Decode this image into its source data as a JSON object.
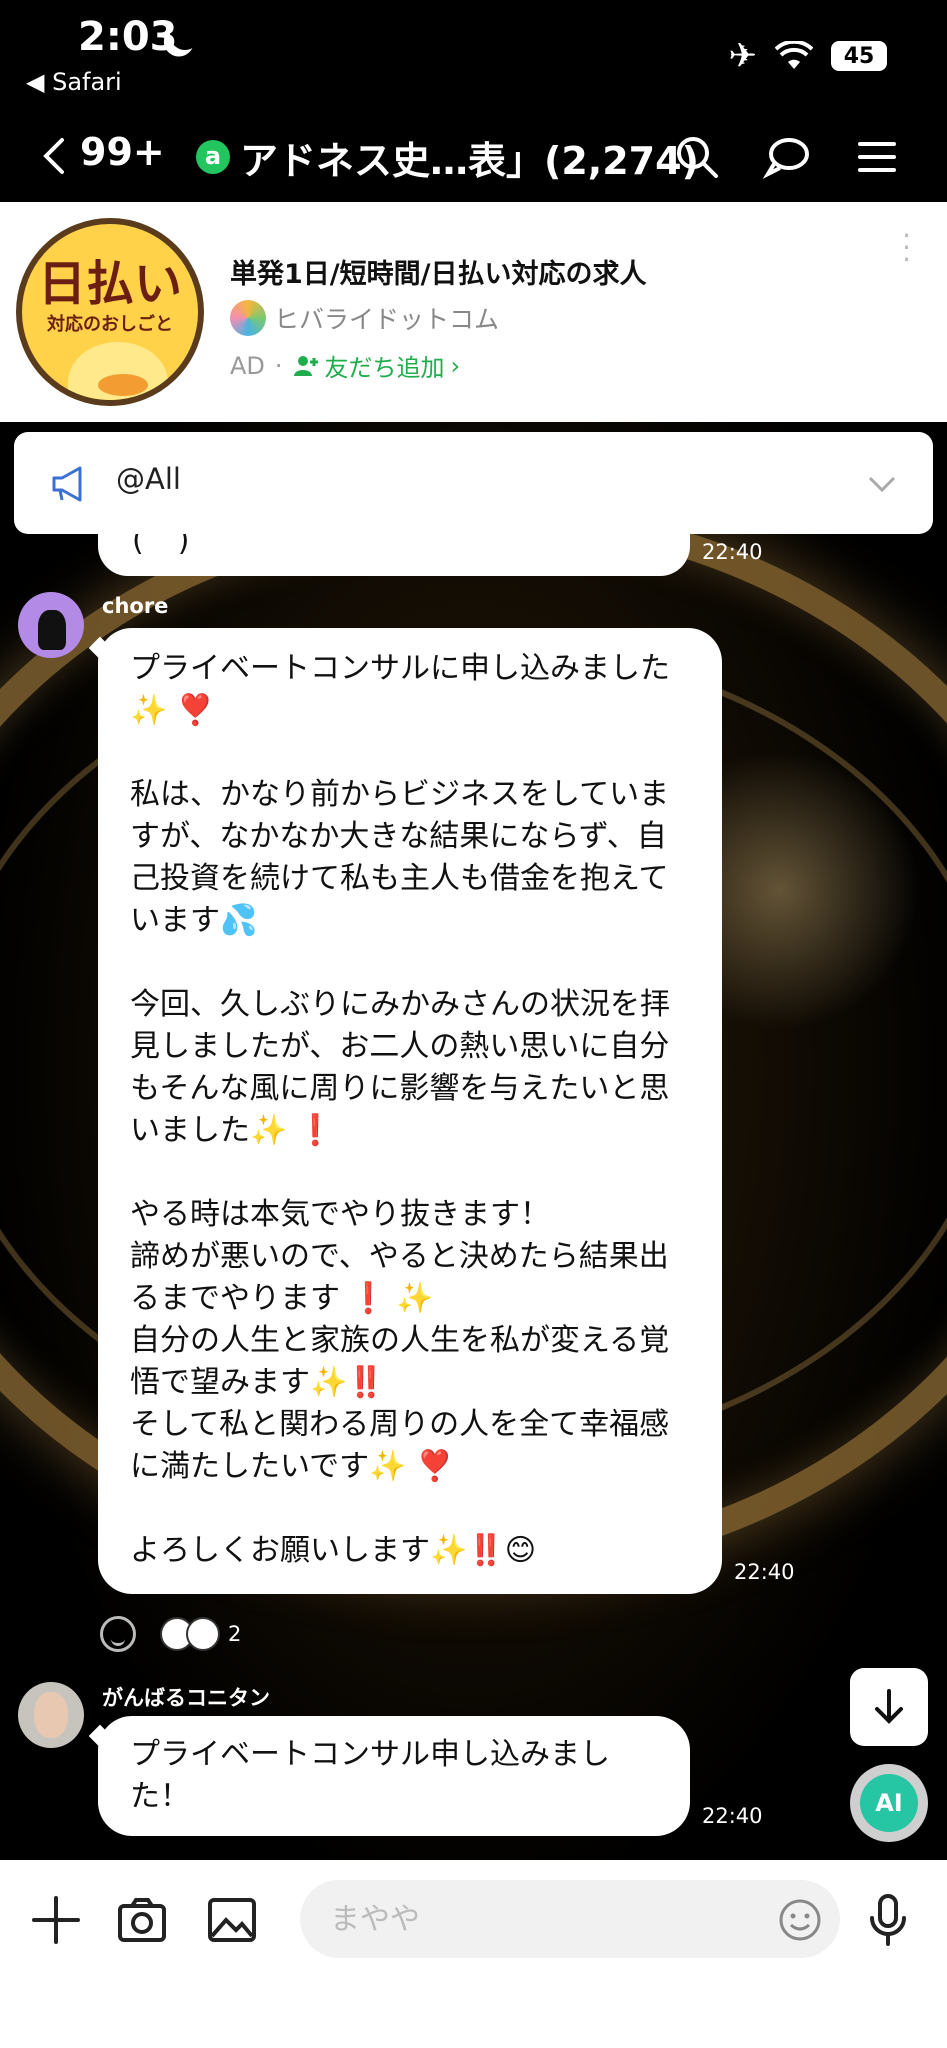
{
  "status_bar": {
    "time": "2:03",
    "back_app": "◀ Safari",
    "battery": "45"
  },
  "nav": {
    "back_count": "99+",
    "title": "アドネス史…表」(2,274)",
    "oa_badge": "a"
  },
  "ad": {
    "logo_big": "日払い",
    "logo_small": "対応のおしごと",
    "title": "単発1日/短時間/日払い対応の求人",
    "sponsor": "ヒバライドットコム",
    "ad_label": "AD",
    "add_friend": "友だち追加"
  },
  "announcement": {
    "label": "@All"
  },
  "messages": [
    {
      "sender": "chore",
      "text": "プライベートコンサルに申し込みました✨ ❣️\n\n私は、かなり前からビジネスをしていますが、なかなか大きな結果にならず、自己投資を続けて私も主人も借金を抱えています💦\n\n今回、久しぶりにみかみさんの状況を拝見しましたが、お二人の熱い思いに自分もそんな風に周りに影響を与えたいと思いました✨ ❗\n\nやる時は本気でやり抜きます！\n諦めが悪いので、やると決めたら結果出るまでやります ❗ ✨\n自分の人生と家族の人生を私が変える覚悟で望みます✨‼️\nそして私と関わる周りの人を全て幸福感に満たしたいです✨ ❣️\n\nよろしくお願いします✨‼️😊",
      "time": "22:40",
      "reaction_count": "2"
    },
    {
      "sender": "がんばるコニタン",
      "text": "プライベートコンサル申し込みました！",
      "time": "22:40"
    }
  ],
  "prev_message": {
    "fragment": "(  ˘  )",
    "time": "22:40"
  },
  "input": {
    "placeholder": "まやや"
  },
  "fab": {
    "ai_label": "AI"
  }
}
